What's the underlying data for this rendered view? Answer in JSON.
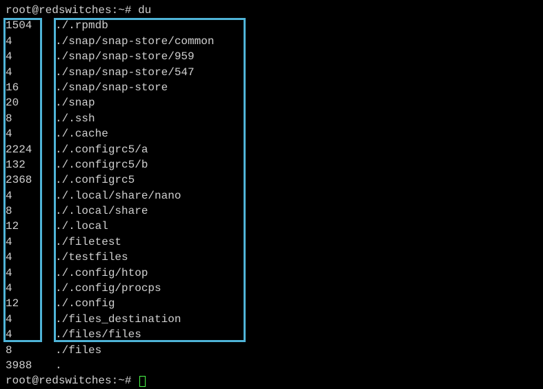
{
  "prompt1": {
    "user": "root",
    "at": "@",
    "host": "redswitches",
    "sep": ":",
    "path": "~",
    "hash": "# ",
    "command": "du"
  },
  "rows": [
    {
      "size": "1504",
      "path": "./.rpmdb"
    },
    {
      "size": "4",
      "path": "./snap/snap-store/common"
    },
    {
      "size": "4",
      "path": "./snap/snap-store/959"
    },
    {
      "size": "4",
      "path": "./snap/snap-store/547"
    },
    {
      "size": "16",
      "path": "./snap/snap-store"
    },
    {
      "size": "20",
      "path": "./snap"
    },
    {
      "size": "8",
      "path": "./.ssh"
    },
    {
      "size": "4",
      "path": "./.cache"
    },
    {
      "size": "2224",
      "path": "./.configrc5/a"
    },
    {
      "size": "132",
      "path": "./.configrc5/b"
    },
    {
      "size": "2368",
      "path": "./.configrc5"
    },
    {
      "size": "4",
      "path": "./.local/share/nano"
    },
    {
      "size": "8",
      "path": "./.local/share"
    },
    {
      "size": "12",
      "path": "./.local"
    },
    {
      "size": "4",
      "path": "./filetest"
    },
    {
      "size": "4",
      "path": "./testfiles"
    },
    {
      "size": "4",
      "path": "./.config/htop"
    },
    {
      "size": "4",
      "path": "./.config/procps"
    },
    {
      "size": "12",
      "path": "./.config"
    },
    {
      "size": "4",
      "path": "./files_destination"
    },
    {
      "size": "4",
      "path": "./files/files"
    },
    {
      "size": "8",
      "path": "./files"
    },
    {
      "size": "3988",
      "path": "."
    }
  ],
  "prompt2": {
    "user": "root",
    "at": "@",
    "host": "redswitches",
    "sep": ":",
    "path": "~",
    "hash": "# "
  }
}
